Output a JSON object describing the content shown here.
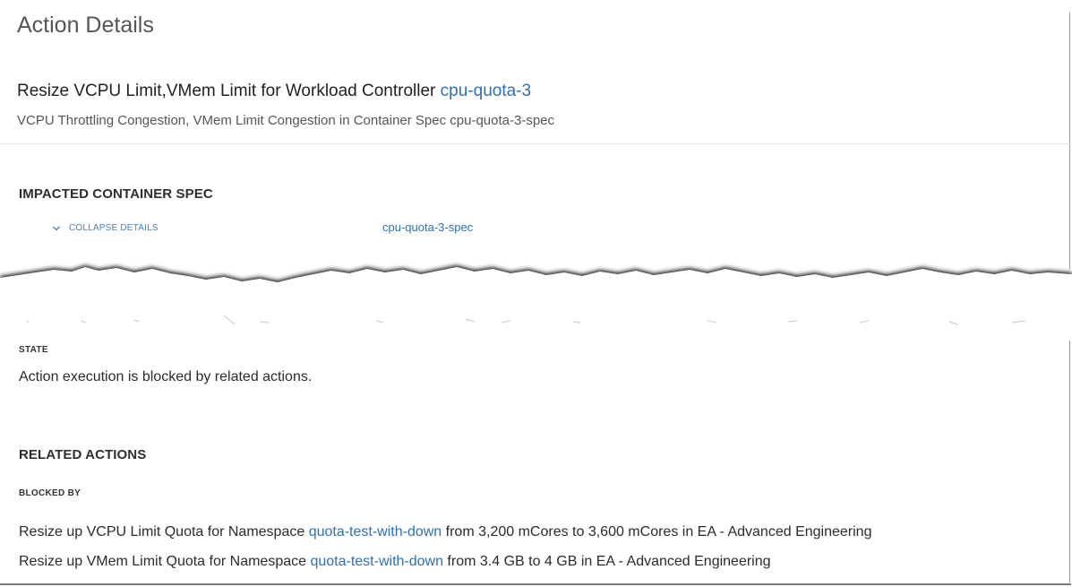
{
  "title": "Action Details",
  "action": {
    "prefix": "Resize VCPU Limit,VMem Limit for Workload Controller ",
    "target_link": "cpu-quota-3",
    "subtitle": "VCPU Throttling Congestion, VMem Limit Congestion in Container Spec cpu-quota-3-spec"
  },
  "impacted": {
    "heading": "IMPACTED CONTAINER SPEC",
    "collapse_label": "COLLAPSE DETAILS",
    "spec_link": "cpu-quota-3-spec"
  },
  "state": {
    "label": "STATE",
    "text": "Action execution is blocked by related actions."
  },
  "related": {
    "heading": "RELATED ACTIONS",
    "blocked_by_label": "BLOCKED BY",
    "items": [
      {
        "prefix": "Resize up VCPU Limit Quota for Namespace ",
        "link": "quota-test-with-down",
        "suffix": " from 3,200 mCores to 3,600 mCores in EA - Advanced Engineering"
      },
      {
        "prefix": "Resize up VMem Limit Quota for Namespace ",
        "link": "quota-test-with-down",
        "suffix": " from 3.4 GB to 4 GB in EA - Advanced Engineering"
      }
    ]
  },
  "colors": {
    "link": "#2f6fb7",
    "text": "#2b2b2b",
    "muted": "#555555"
  }
}
